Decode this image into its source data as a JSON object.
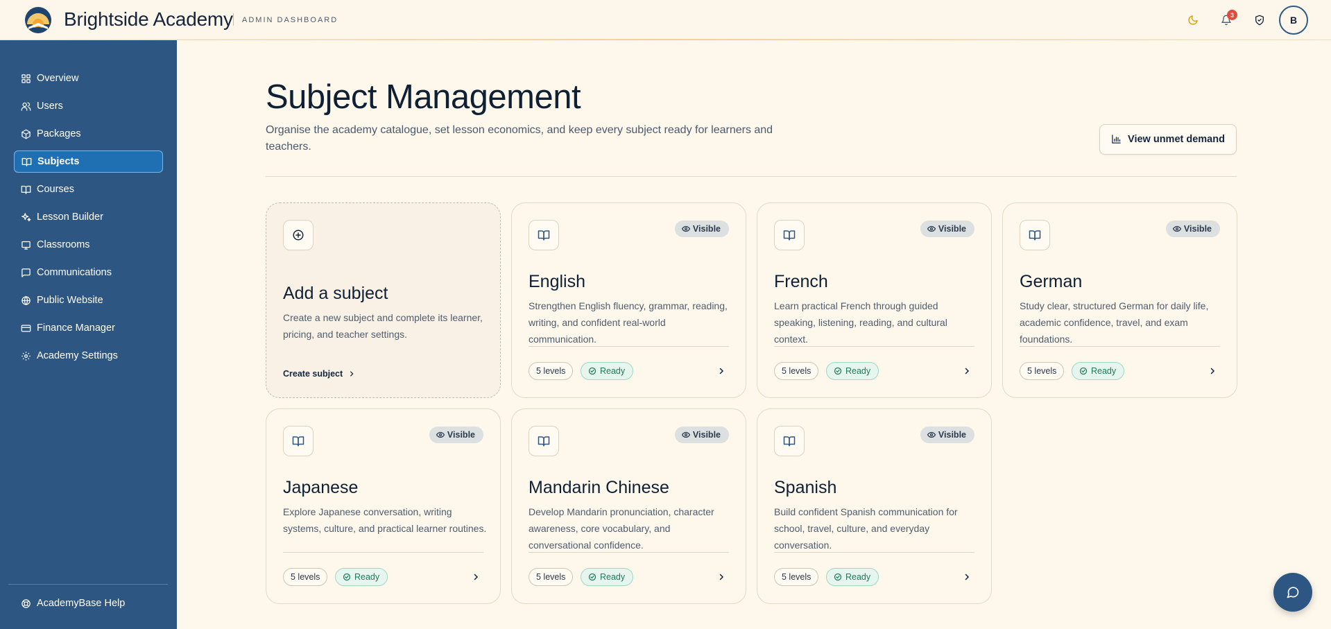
{
  "header": {
    "brand": "Brightside Academy",
    "subtitle": "ADMIN DASHBOARD",
    "notification_count": "3",
    "avatar_initial": "B"
  },
  "sidebar": {
    "items": [
      {
        "label": "Overview",
        "icon": "grid-icon"
      },
      {
        "label": "Users",
        "icon": "user-icon"
      },
      {
        "label": "Packages",
        "icon": "package-icon"
      },
      {
        "label": "Subjects",
        "icon": "book-icon",
        "active": true
      },
      {
        "label": "Courses",
        "icon": "book-icon"
      },
      {
        "label": "Lesson Builder",
        "icon": "sparkle-icon"
      },
      {
        "label": "Classrooms",
        "icon": "screen-icon"
      },
      {
        "label": "Communications",
        "icon": "chat-icon"
      },
      {
        "label": "Public Website",
        "icon": "globe-icon"
      },
      {
        "label": "Finance Manager",
        "icon": "card-icon"
      },
      {
        "label": "Academy Settings",
        "icon": "gear-icon"
      }
    ],
    "help_label": "AcademyBase Help"
  },
  "main": {
    "title": "Subject Management",
    "description": "Organise the academy catalogue, set lesson economics, and keep every subject ready for learners and teachers.",
    "demand_button": "View unmet demand",
    "add_card": {
      "title": "Add a subject",
      "description": "Create a new subject and complete its learner, pricing, and teacher settings.",
      "link": "Create subject"
    },
    "subjects": [
      {
        "name": "English",
        "description": "Strengthen English fluency, grammar, reading, writing, and confident real-world communication.",
        "visibility": "Visible",
        "levels": "5 levels",
        "status": "Ready"
      },
      {
        "name": "French",
        "description": "Learn practical French through guided speaking, listening, reading, and cultural context.",
        "visibility": "Visible",
        "levels": "5 levels",
        "status": "Ready"
      },
      {
        "name": "German",
        "description": "Study clear, structured German for daily life, academic confidence, travel, and exam foundations.",
        "visibility": "Visible",
        "levels": "5 levels",
        "status": "Ready"
      },
      {
        "name": "Japanese",
        "description": "Explore Japanese conversation, writing systems, culture, and practical learner routines.",
        "visibility": "Visible",
        "levels": "5 levels",
        "status": "Ready"
      },
      {
        "name": "Mandarin Chinese",
        "description": "Develop Mandarin pronunciation, character awareness, core vocabulary, and conversational confidence.",
        "visibility": "Visible",
        "levels": "5 levels",
        "status": "Ready"
      },
      {
        "name": "Spanish",
        "description": "Build confident Spanish communication for school, travel, culture, and everyday conversation.",
        "visibility": "Visible",
        "levels": "5 levels",
        "status": "Ready"
      }
    ]
  }
}
